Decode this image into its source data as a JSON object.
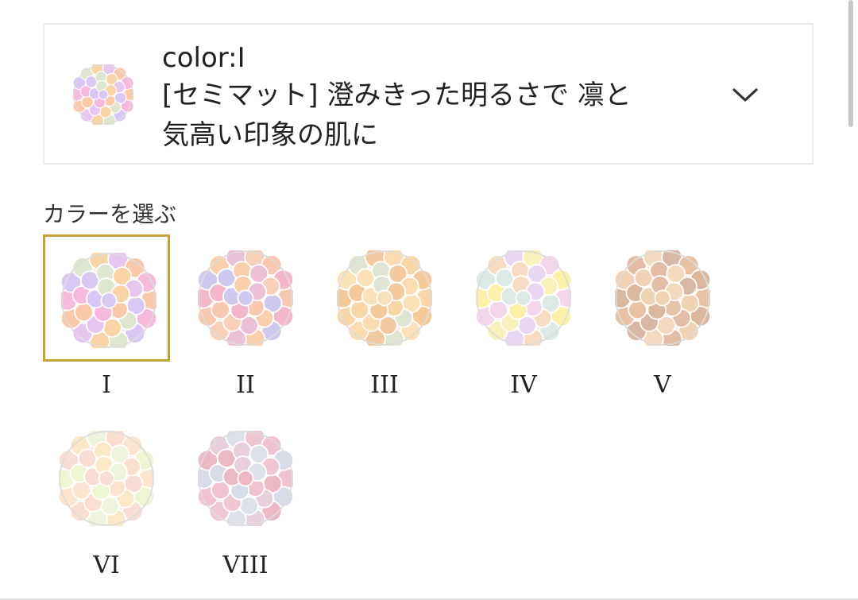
{
  "selected": {
    "code": "color:I",
    "description": "[セミマット] 澄みきった明るさで 凛と\n気高い印象の肌に"
  },
  "section_title": "カラーを選ぶ",
  "colors": [
    {
      "label": "I",
      "palette": [
        "#fbc9a8",
        "#f7b9dc",
        "#d9c8f3",
        "#dfe6cf",
        "#f9d4a6",
        "#e7c6f0"
      ]
    },
    {
      "label": "II",
      "palette": [
        "#f8c8b0",
        "#f4b6c9",
        "#cfc9ee",
        "#f9cfae",
        "#ecc0d6",
        "#f6d0b8"
      ]
    },
    {
      "label": "III",
      "palette": [
        "#f8d6a8",
        "#f6c99a",
        "#fbe1b8",
        "#dfe5d2",
        "#f3caa0",
        "#fadbb2"
      ]
    },
    {
      "label": "IV",
      "palette": [
        "#f3d6ea",
        "#fbf0a8",
        "#dde9e4",
        "#f6dcc2",
        "#e9d6f1",
        "#f9f1bb"
      ]
    },
    {
      "label": "V",
      "palette": [
        "#e8c3a6",
        "#dbb7a0",
        "#f0d2b5",
        "#e2bea8",
        "#f3d9bf",
        "#d9b7a6"
      ]
    },
    {
      "label": "VI",
      "palette": [
        "#fbe4d0",
        "#eef5d5",
        "#f7ddd6",
        "#fbe8c9",
        "#eef3dd",
        "#f9dfcf"
      ]
    },
    {
      "label": "VIII",
      "palette": [
        "#f1c3d0",
        "#d8dbe8",
        "#ecb8c5",
        "#e7d0dc",
        "#dfe1ea",
        "#efc7d3"
      ]
    }
  ],
  "icons": {
    "dropdown": "chevron-down-icon"
  }
}
